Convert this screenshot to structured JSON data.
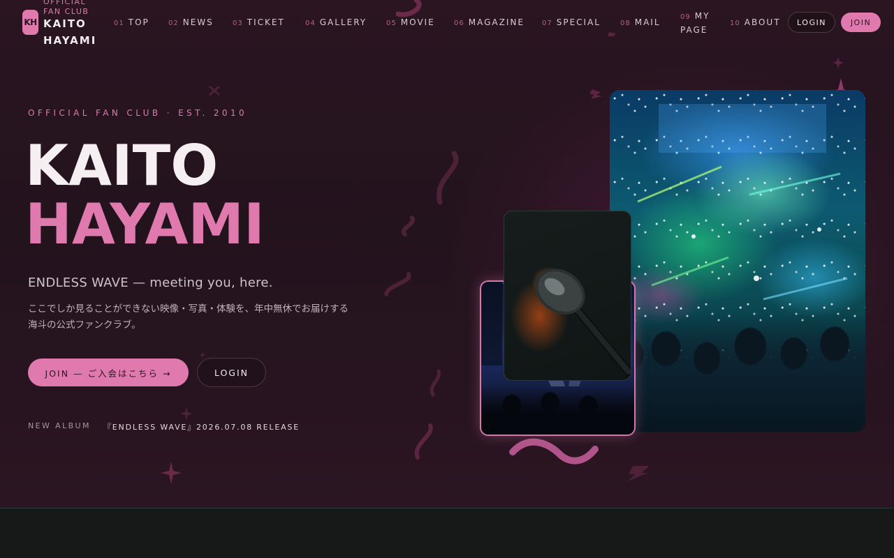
{
  "brand": {
    "badge": "KH",
    "sub": "OFFICIAL FAN CLUB",
    "name": "KAITO HAYAMI"
  },
  "nav": [
    {
      "num": "01",
      "label": "TOP"
    },
    {
      "num": "02",
      "label": "NEWS"
    },
    {
      "num": "03",
      "label": "TICKET"
    },
    {
      "num": "04",
      "label": "GALLERY"
    },
    {
      "num": "05",
      "label": "MOVIE"
    },
    {
      "num": "06",
      "label": "MAGAZINE"
    },
    {
      "num": "07",
      "label": "SPECIAL"
    },
    {
      "num": "08",
      "label": "MAIL"
    },
    {
      "num": "09",
      "label": "MY PAGE"
    },
    {
      "num": "10",
      "label": "ABOUT"
    }
  ],
  "header_actions": {
    "login": "LOGIN",
    "join": "JOIN"
  },
  "hero": {
    "eyebrow": "OFFICIAL FAN CLUB · EST. 2010",
    "title_line1": "KAITO",
    "title_line2": "HAYAMI",
    "tagline": "ENDLESS WAVE — meeting you, here.",
    "description": "ここでしか見ることができない映像・写真・体験を、年中無休でお届けする海斗の公式ファンクラブ。",
    "join_cta": "JOIN — ご入会はこちら →",
    "login_cta": "LOGIN",
    "album_label": "NEW ALBUM",
    "album_value": "『ENDLESS WAVE』2026.07.08 RELEASE"
  },
  "colors": {
    "accent": "#e07aae",
    "background": "#23131d",
    "text": "#f3ecef"
  },
  "icons": {
    "arrow": "arrow-right-icon",
    "bolt": "lightning-bolt-icon",
    "sparkle": "sparkle-icon",
    "wave": "wave-icon"
  }
}
